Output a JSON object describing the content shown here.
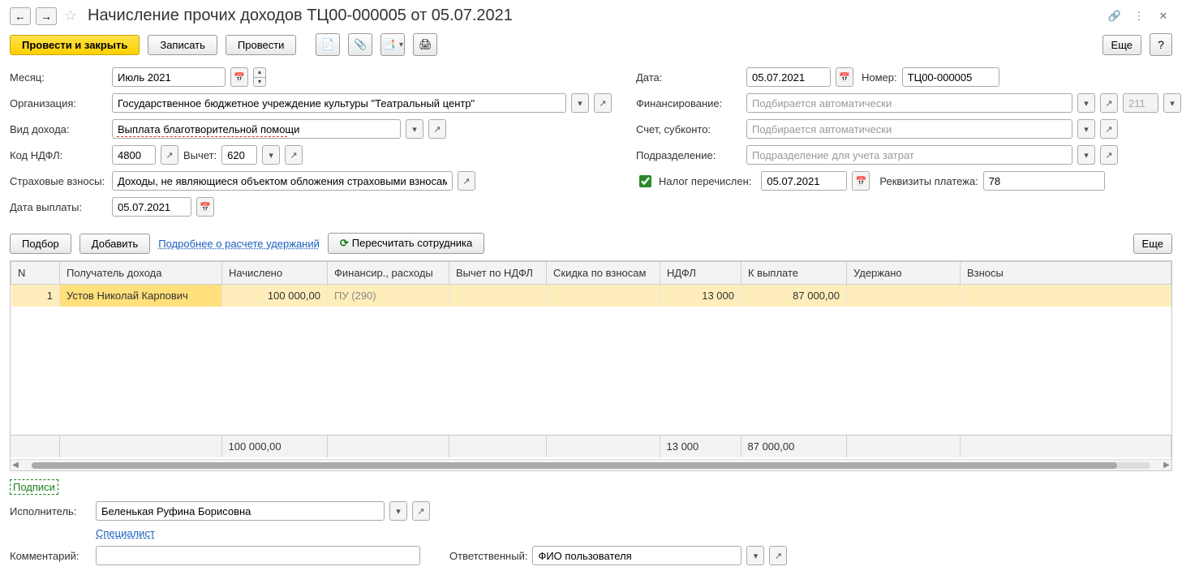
{
  "header": {
    "title": "Начисление прочих доходов ТЦ00-000005 от 05.07.2021"
  },
  "toolbar": {
    "post_close": "Провести и закрыть",
    "save": "Записать",
    "post": "Провести",
    "more": "Еще",
    "help": "?"
  },
  "form": {
    "month_label": "Месяц:",
    "month": "Июль 2021",
    "org_label": "Организация:",
    "org": "Государственное бюджетное учреждение культуры \"Театральный центр\"",
    "income_type_label": "Вид дохода:",
    "income_type": "Выплата благотворительной помощи",
    "ndfl_code_label": "Код НДФЛ:",
    "ndfl_code": "4800",
    "deduction_label": "Вычет:",
    "deduction": "620",
    "insurance_label": "Страховые взносы:",
    "insurance": "Доходы, не являющиеся объектом обложения страховыми взносами",
    "pay_date_label": "Дата выплаты:",
    "pay_date": "05.07.2021",
    "date_label": "Дата:",
    "date": "05.07.2021",
    "number_label": "Номер:",
    "number": "ТЦ00-000005",
    "fin_label": "Финансирование:",
    "fin_placeholder": "Подбирается автоматически",
    "fin_num": "211",
    "account_label": "Счет, субконто:",
    "account_placeholder": "Подбирается автоматически",
    "dept_label": "Подразделение:",
    "dept_placeholder": "Подразделение для учета затрат",
    "tax_paid_label": "Налог перечислен:",
    "tax_paid_date": "05.07.2021",
    "pay_req_label": "Реквизиты платежа:",
    "pay_req": "78"
  },
  "actions": {
    "pick": "Подбор",
    "add": "Добавить",
    "details": "Подробнее о расчете удержаний",
    "recalc": "Пересчитать сотрудника",
    "more": "Еще"
  },
  "table": {
    "headers": {
      "n": "N",
      "recipient": "Получатель дохода",
      "accrued": "Начислено",
      "fin": "Финансир., расходы",
      "ndfl_ded": "Вычет по НДФЛ",
      "discount": "Скидка по взносам",
      "ndfl": "НДФЛ",
      "to_pay": "К выплате",
      "withheld": "Удержано",
      "fees": "Взносы"
    },
    "rows": [
      {
        "n": "1",
        "recipient": "Устов Николай Карпович",
        "accrued": "100 000,00",
        "fin": "ПУ   (290)",
        "ndfl_ded": "",
        "discount": "",
        "ndfl": "13 000",
        "to_pay": "87 000,00",
        "withheld": "",
        "fees": ""
      }
    ],
    "totals": {
      "accrued": "100 000,00",
      "ndfl": "13 000",
      "to_pay": "87 000,00"
    }
  },
  "footer": {
    "signatures": "Подписи",
    "performer_label": "Исполнитель:",
    "performer": "Беленькая Руфина Борисовна",
    "specialist": "Специалист",
    "comment_label": "Комментарий:",
    "responsible_label": "Ответственный:",
    "responsible": "ФИО пользователя"
  }
}
